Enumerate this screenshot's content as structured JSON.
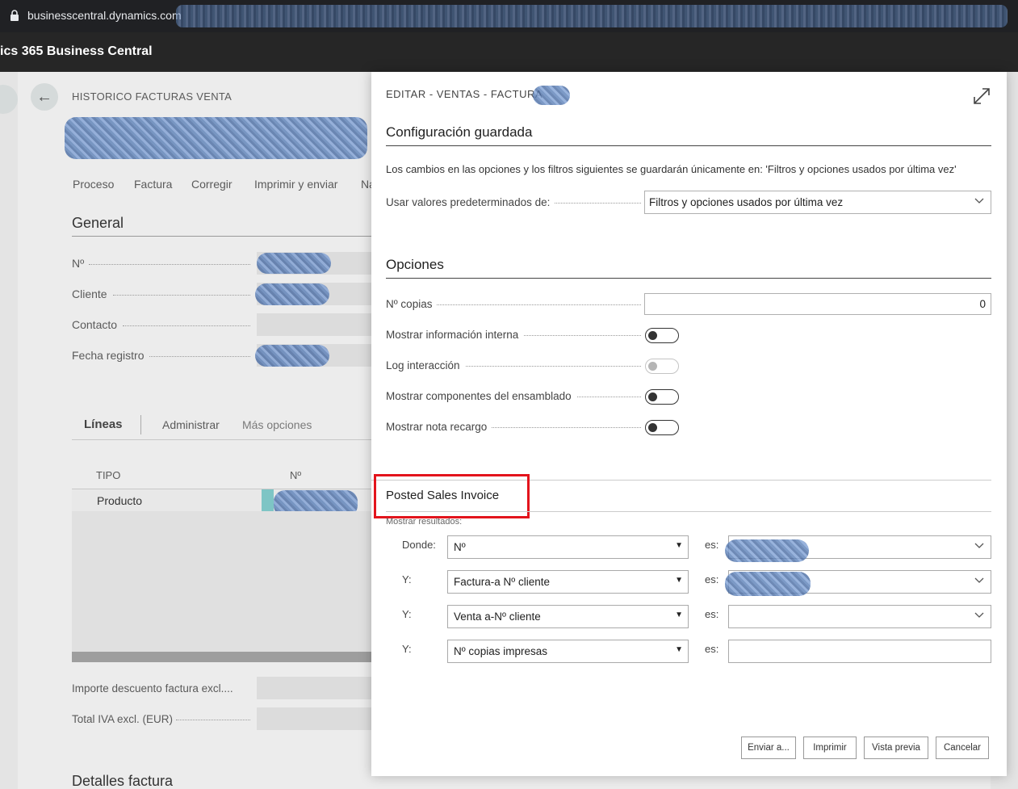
{
  "browser": {
    "url": "businesscentral.dynamics.com"
  },
  "app": {
    "title": "ics 365 Business Central"
  },
  "background": {
    "page_caption": "HISTORICO FACTURAS VENTA",
    "actions": [
      "Proceso",
      "Factura",
      "Corregir",
      "Imprimir y enviar",
      "Na"
    ],
    "general_heading": "General",
    "fields": [
      "Nº",
      "Cliente",
      "Contacto",
      "Fecha registro"
    ],
    "lines": {
      "title": "Líneas",
      "manage": "Administrar",
      "more": "Más opciones",
      "col_type": "TIPO",
      "col_no": "Nº",
      "row_type": "Producto"
    },
    "totals": [
      "Importe descuento factura excl....",
      "Total IVA excl. (EUR)"
    ],
    "details_heading": "Detalles factura"
  },
  "dialog": {
    "caption": "EDITAR - VENTAS - FACTURA",
    "saved": {
      "title": "Configuración guardada",
      "info": "Los cambios en las opciones y los filtros siguientes se guardarán únicamente en: 'Filtros y opciones usados por última vez'",
      "default_label": "Usar valores predeterminados de:",
      "default_value": "Filtros y opciones usados por última vez"
    },
    "options": {
      "title": "Opciones",
      "copies_label": "Nº copias",
      "copies_value": "0",
      "toggles": [
        {
          "label": "Mostrar información interna",
          "on": false,
          "enabled": true
        },
        {
          "label": "Log interacción",
          "on": false,
          "enabled": false
        },
        {
          "label": "Mostrar componentes del ensamblado",
          "on": false,
          "enabled": true
        },
        {
          "label": "Mostrar nota recargo",
          "on": false,
          "enabled": true
        }
      ]
    },
    "filters": {
      "title": "Posted Sales Invoice",
      "show_results": "Mostrar resultados:",
      "rows": [
        {
          "prefix": "Donde:",
          "field": "Nº",
          "op": "es:"
        },
        {
          "prefix": "Y:",
          "field": "Factura-a Nº cliente",
          "op": "es:"
        },
        {
          "prefix": "Y:",
          "field": "Venta a-Nº cliente",
          "op": "es:"
        },
        {
          "prefix": "Y:",
          "field": "Nº copias impresas",
          "op": "es:"
        }
      ]
    },
    "buttons": {
      "send": "Enviar a...",
      "print": "Imprimir",
      "preview": "Vista previa",
      "cancel": "Cancelar"
    }
  }
}
